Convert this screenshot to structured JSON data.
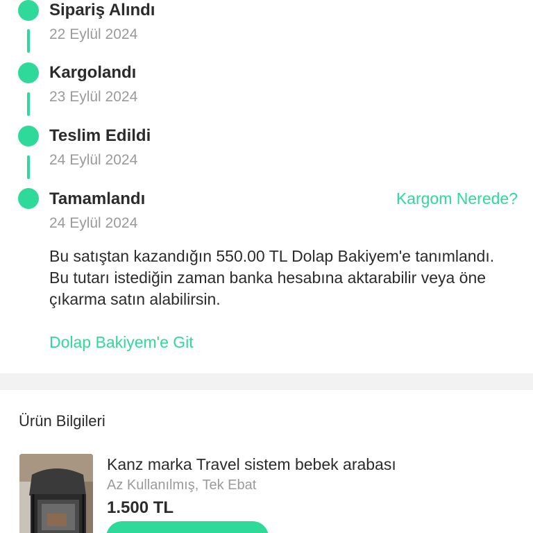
{
  "timeline": {
    "steps": [
      {
        "title": "Sipariş Alındı",
        "date": "22 Eylül 2024"
      },
      {
        "title": "Kargolandı",
        "date": "23 Eylül 2024"
      },
      {
        "title": "Teslim Edildi",
        "date": "24 Eylül 2024"
      },
      {
        "title": "Tamamlandı",
        "date": "24 Eylül 2024"
      }
    ],
    "cargo_link": "Kargom Nerede?",
    "info_text": "Bu satıştan kazandığın 550.00 TL Dolap Bakiyem'e tanımlandı. Bu tutarı istediğin zaman banka hesabına aktarabilir veya öne çıkarma satın alabilirsin.",
    "balance_link": "Dolap Bakiyem'e Git"
  },
  "product": {
    "section_title": "Ürün Bilgileri",
    "name": "Kanz marka Travel sistem bebek arabası",
    "condition": "Az Kullanılmış, Tek Ebat",
    "price": "1.500 TL"
  },
  "colors": {
    "accent": "#2fd99a",
    "text": "#2b2b2b",
    "muted": "#9a9a9a",
    "separator": "#f2f2f2"
  }
}
